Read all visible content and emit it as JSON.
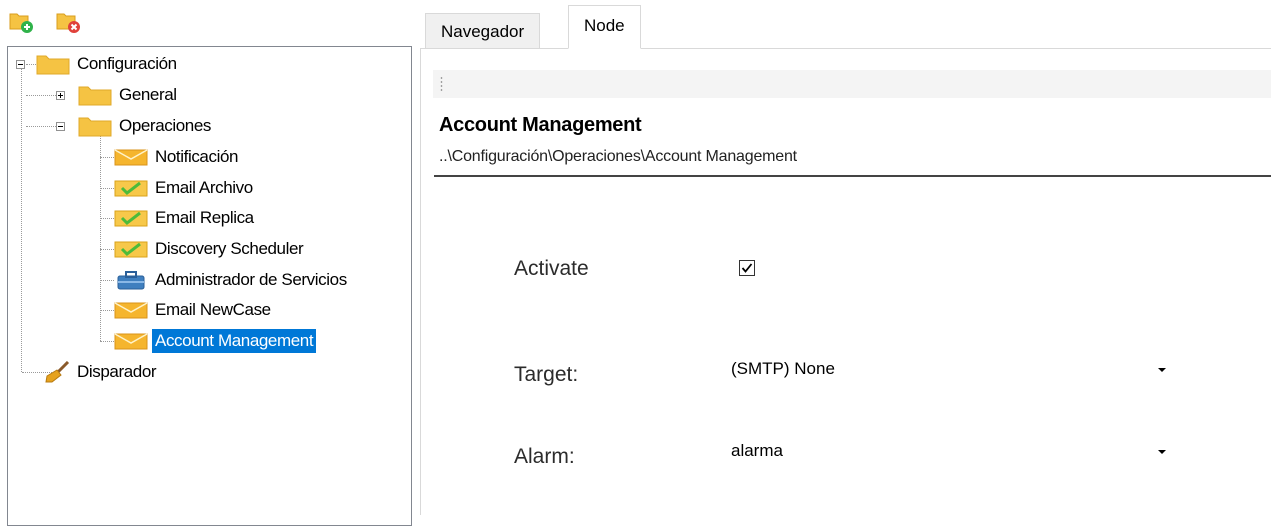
{
  "toolbar": {
    "add_icon": "folder-add-icon",
    "remove_icon": "folder-remove-icon"
  },
  "tree": {
    "root": {
      "label": "Configuración",
      "icon": "folder-icon",
      "expanded": true
    },
    "general": {
      "label": "General",
      "icon": "folder-icon",
      "expanded": false
    },
    "operaciones": {
      "label": "Operaciones",
      "icon": "folder-icon",
      "expanded": true
    },
    "items": [
      {
        "label": "Notificación",
        "icon": "envelope-icon"
      },
      {
        "label": "Email Archivo",
        "icon": "envelope-check-icon"
      },
      {
        "label": "Email Replica",
        "icon": "envelope-check-icon"
      },
      {
        "label": "Discovery Scheduler",
        "icon": "envelope-check-icon"
      },
      {
        "label": "Administrador de Servicios",
        "icon": "toolbox-icon"
      },
      {
        "label": "Email NewCase",
        "icon": "envelope-icon"
      },
      {
        "label": "Account Management",
        "icon": "envelope-icon",
        "selected": true
      }
    ],
    "disparador": {
      "label": "Disparador",
      "icon": "broom-icon"
    }
  },
  "tabs": [
    {
      "label": "Navegador",
      "active": false
    },
    {
      "label": "Node",
      "active": true
    }
  ],
  "main": {
    "title": "Account Management",
    "path": "..\\Configuración\\Operaciones\\Account Management",
    "activate_label": "Activate",
    "activate_checked": true,
    "target_label": "Target:",
    "target_value": "(SMTP) None",
    "alarm_label": "Alarm:",
    "alarm_value": "alarma"
  },
  "colors": {
    "selection": "#0078d7",
    "folder": "#f5c343",
    "envelope": "#f5b52e"
  }
}
